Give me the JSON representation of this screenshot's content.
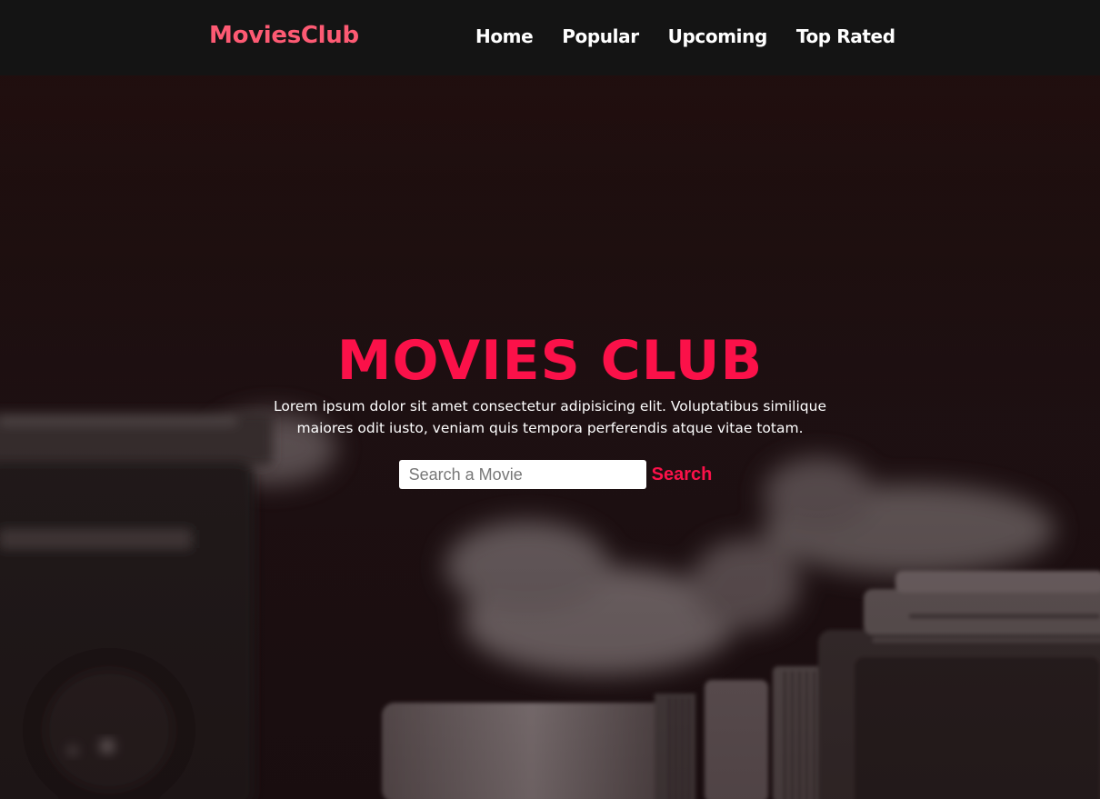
{
  "navbar": {
    "brand": "MoviesClub",
    "links": [
      {
        "label": "Home"
      },
      {
        "label": "Popular"
      },
      {
        "label": "Upcoming"
      },
      {
        "label": "Top Rated"
      }
    ]
  },
  "hero": {
    "title": "MOVIES CLUB",
    "description": "Lorem ipsum dolor sit amet consectetur adipisicing elit. Voluptatibus similique maiores odit iusto, veniam quis tempora perferendis atque vitae totam.",
    "search": {
      "placeholder": "Search a Movie",
      "value": "",
      "button_label": "Search"
    }
  },
  "colors": {
    "accent": "#fb1149",
    "brand": "#fd5a73",
    "navbar_bg": "#141414"
  }
}
